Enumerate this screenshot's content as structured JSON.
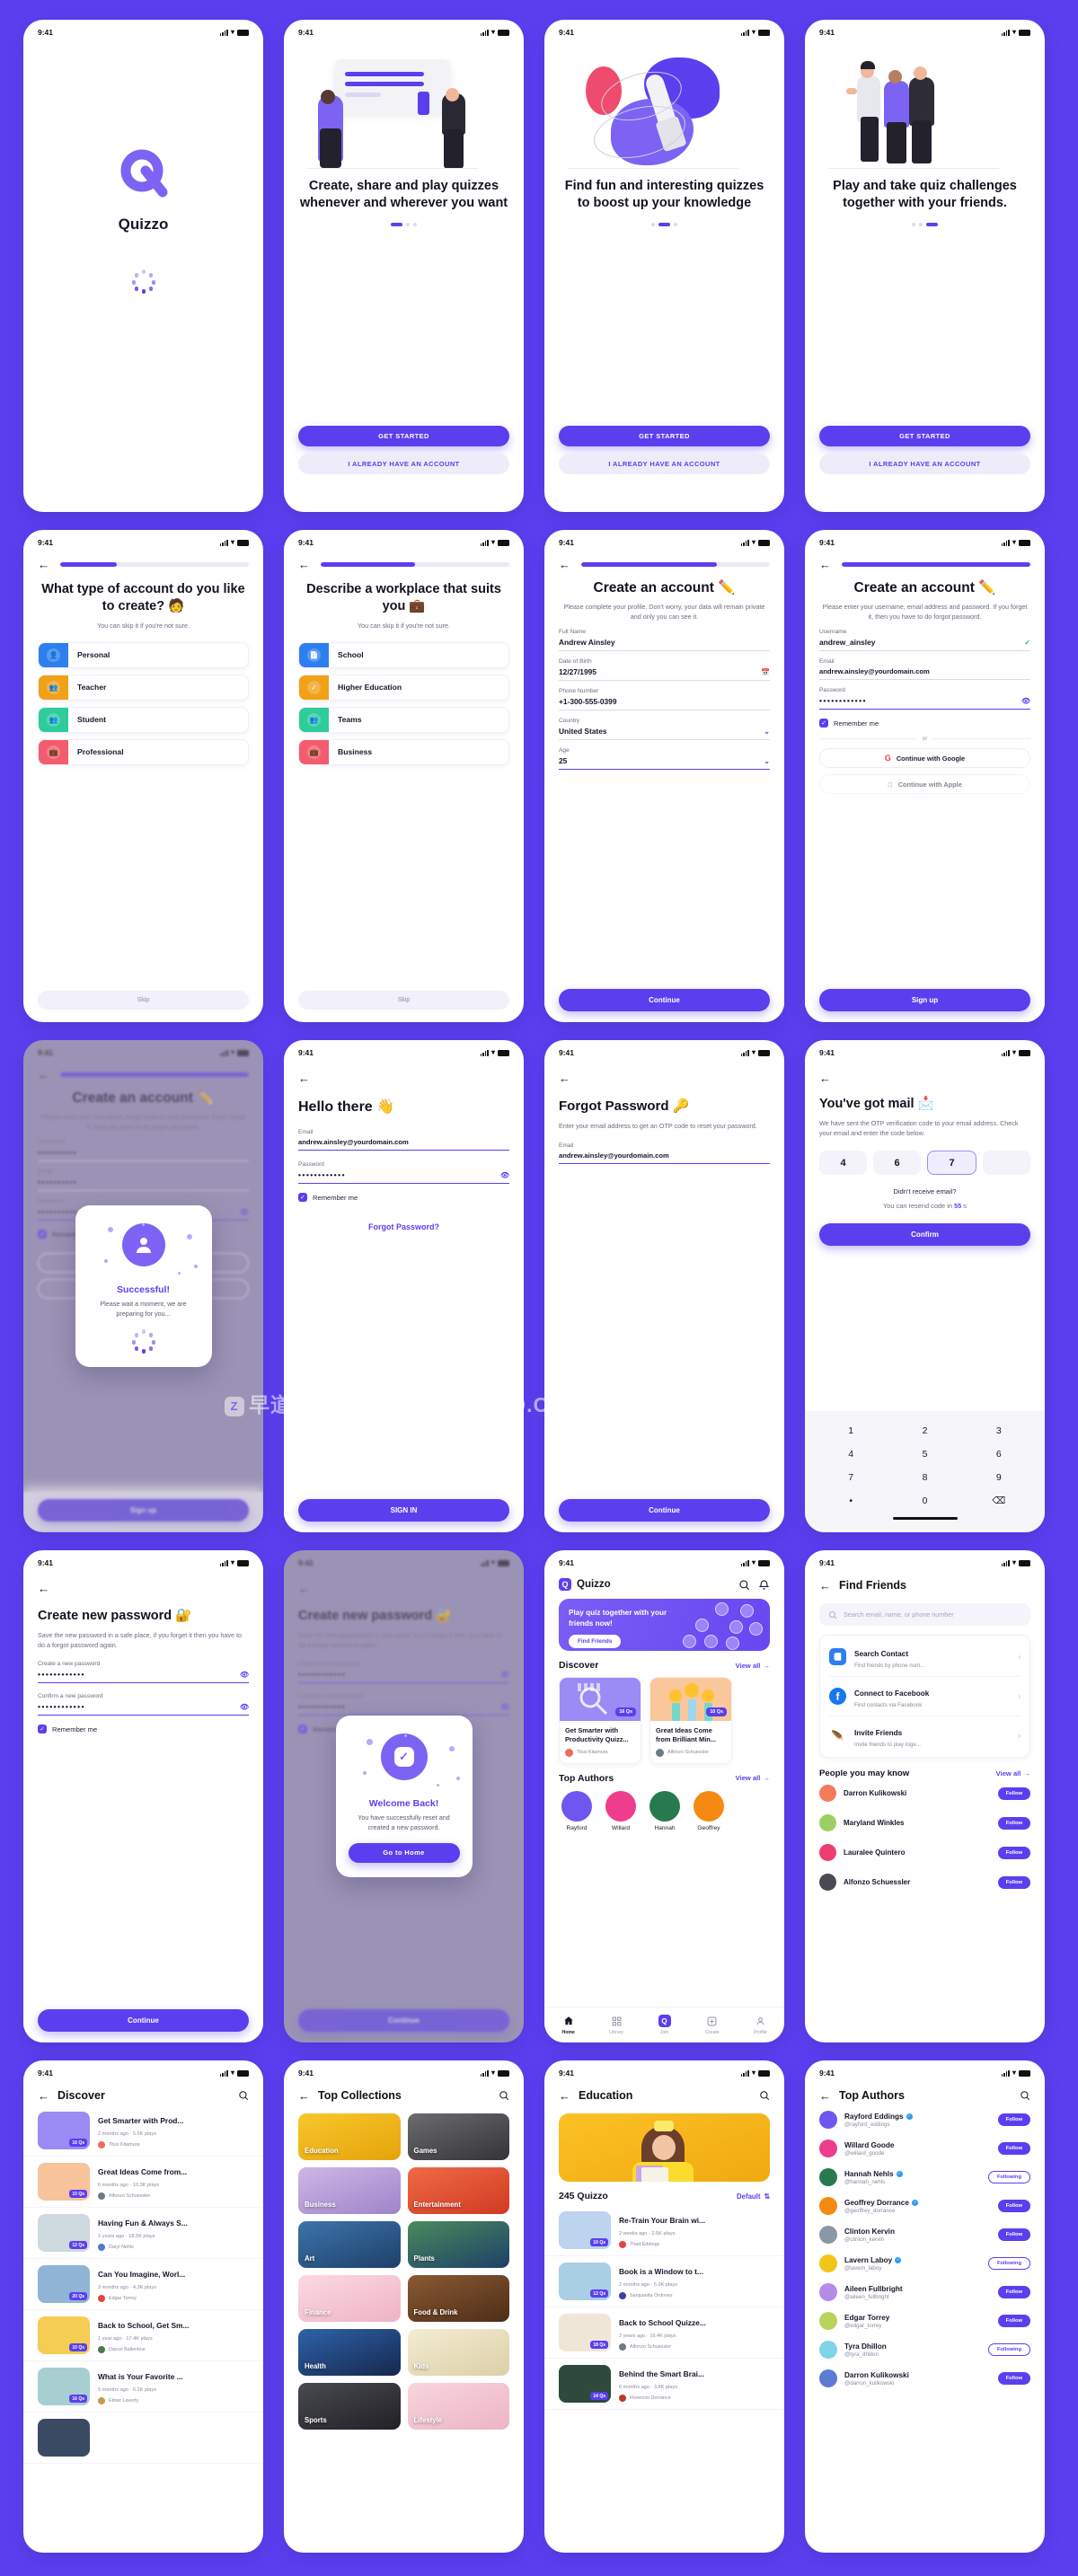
{
  "brand": {
    "name": "Quizzo",
    "accent": "#5B3FEF",
    "logo_glyph": "Q"
  },
  "status_bar": {
    "time": "9:41",
    "icons": [
      "signal-bars",
      "wifi",
      "battery"
    ]
  },
  "watermark": {
    "text_cn": "早道大咖",
    "text_en": "IAMDK.TAOBAO.COM"
  },
  "screens": {
    "splash": {
      "app_name": "Quizzo"
    },
    "onboarding": [
      {
        "headline": "Create, share and play quizzes whenever and wherever you want",
        "active_dot": 0,
        "primary": "GET STARTED",
        "secondary": "I ALREADY HAVE AN ACCOUNT"
      },
      {
        "headline": "Find fun and interesting quizzes to boost up your knowledge",
        "active_dot": 1,
        "primary": "GET STARTED",
        "secondary": "I ALREADY HAVE AN ACCOUNT"
      },
      {
        "headline": "Play and take quiz challenges together with your friends.",
        "active_dot": 2,
        "primary": "GET STARTED",
        "secondary": "I ALREADY HAVE AN ACCOUNT"
      }
    ],
    "account_type": {
      "progress": 30,
      "title": "What type of account do you like to create? 🧑",
      "subtitle": "You can skip it if you're not sure.",
      "options": [
        {
          "label": "Personal",
          "color": "#2D7FF0",
          "icon": "person-icon"
        },
        {
          "label": "Teacher",
          "color": "#F0A117",
          "icon": "people-two-icon"
        },
        {
          "label": "Student",
          "color": "#2ECC9B",
          "icon": "people-group-icon"
        },
        {
          "label": "Professional",
          "color": "#F25C6E",
          "icon": "briefcase-icon"
        }
      ],
      "skip": "Skip"
    },
    "workplace": {
      "progress": 50,
      "title": "Describe a workplace that suits you 💼",
      "subtitle": "You can skip it if you're not sure.",
      "options": [
        {
          "label": "School",
          "color": "#2D7FF0",
          "icon": "document-icon"
        },
        {
          "label": "Higher Education",
          "color": "#F0A117",
          "icon": "check-badge-icon"
        },
        {
          "label": "Teams",
          "color": "#2ECC9B",
          "icon": "people-group-icon"
        },
        {
          "label": "Business",
          "color": "#F25C6E",
          "icon": "briefcase-icon"
        }
      ],
      "skip": "Skip"
    },
    "create_account_profile": {
      "progress": 70,
      "title": "Create an account ✏️",
      "subtitle": "Please complete your profile. Don't worry, your data will remain private and only you can see it.",
      "fields": [
        {
          "label": "Full Name",
          "value": "Andrew Ainsley",
          "icon": null
        },
        {
          "label": "Date of Birth",
          "value": "12/27/1995",
          "icon": "calendar-icon"
        },
        {
          "label": "Phone Number",
          "value": "+1-300-555-0399",
          "icon": null
        },
        {
          "label": "Country",
          "value": "United States",
          "icon": "chevron-down-icon"
        },
        {
          "label": "Age",
          "value": "25",
          "icon": "chevron-down-icon"
        }
      ],
      "cta": "Continue"
    },
    "create_account_credentials": {
      "progress": 100,
      "title": "Create an account ✏️",
      "subtitle": "Please enter your username, email address and password. If you forget it, then you have to do forgot password.",
      "fields": [
        {
          "label": "Username",
          "value": "andrew_ainsley",
          "icon": "check-icon"
        },
        {
          "label": "Email",
          "value": "andrew.ainsley@yourdomain.com",
          "icon": null
        },
        {
          "label": "Password",
          "value": "••••••••••••",
          "icon": "eye-off-icon"
        }
      ],
      "remember_me": "Remember me",
      "or": "or",
      "social": [
        {
          "label": "Continue with Google",
          "icon": "google-icon"
        },
        {
          "label": "Continue with Apple",
          "icon": "apple-icon"
        }
      ],
      "cta": "Sign up"
    },
    "successful_modal": {
      "behind_title": "Create an account ✏️",
      "behind_cta": "Sign up",
      "behind_social": "Continue with Google",
      "modal_title": "Successful!",
      "modal_sub": "Please wait a moment, we are preparing for you...",
      "icon": "user-avatar-icon"
    },
    "sign_in": {
      "title": "Hello there 👋",
      "fields": [
        {
          "label": "Email",
          "value": "andrew.ainsley@yourdomain.com",
          "icon": null
        },
        {
          "label": "Password",
          "value": "••••••••••••",
          "icon": "eye-off-icon"
        }
      ],
      "remember_me": "Remember me",
      "forgot_link": "Forgot Password?",
      "cta": "SIGN IN"
    },
    "forgot_password": {
      "title": "Forgot Password 🔑",
      "subtitle": "Enter your email address to get an OTP code to reset your password.",
      "fields": [
        {
          "label": "Email",
          "value": "andrew.ainsley@yourdomain.com"
        }
      ],
      "cta": "Continue"
    },
    "otp": {
      "title": "You've got mail 📩",
      "subtitle": "We have sent the OTP verification code to your email address. Check your email and enter the code below.",
      "digits": [
        "4",
        "6",
        "7",
        ""
      ],
      "selected_index": 2,
      "resend_q": "Didn't receive email?",
      "resend_pre": "You can resend code in ",
      "resend_count": "55",
      "resend_post": " s",
      "cta": "Confirm",
      "keypad": [
        "1",
        "2",
        "3",
        "4",
        "5",
        "6",
        "7",
        "8",
        "9",
        "•",
        "0",
        "⌫"
      ]
    },
    "new_password": {
      "title": "Create new password 🔐",
      "subtitle": "Save the new password in a safe place, if you forget it then you have to do a forgot password again.",
      "fields": [
        {
          "label": "Create a new password",
          "value": "••••••••••••",
          "icon": "eye-off-icon"
        },
        {
          "label": "Confirm a new password",
          "value": "••••••••••••",
          "icon": "eye-off-icon"
        }
      ],
      "remember_me": "Remember me",
      "cta": "Continue"
    },
    "welcome_back_modal": {
      "behind_title": "Create new password 🔐",
      "behind_cta": "Continue",
      "modal_title": "Welcome Back!",
      "modal_sub": "You have successfully reset and created a new password.",
      "modal_cta": "Go to Home",
      "icon": "check-badge-icon"
    },
    "home": {
      "brand": "Quizzo",
      "header_icons": [
        "search-icon",
        "bell-icon"
      ],
      "banner": {
        "text": "Play quiz together with your friends now!",
        "cta": "Find Friends"
      },
      "discover": {
        "title": "Discover",
        "view_all": "View all",
        "cards": [
          {
            "title": "Get Smarter with Productivity Quizz...",
            "author": "Titus Kitamura",
            "qs": "16 Qs",
            "color": "#9a8bf5"
          },
          {
            "title": "Great Ideas Come from Brilliant Min...",
            "author": "Alfonzo Schuessler",
            "qs": "10 Qs",
            "color": "#f9c79a"
          }
        ]
      },
      "top_authors": {
        "title": "Top Authors",
        "view_all": "View all",
        "authors": [
          {
            "name": "Rayford",
            "color": "#6E56F0"
          },
          {
            "name": "Willard",
            "color": "#EE3D8C"
          },
          {
            "name": "Hannah",
            "color": "#277A4E"
          },
          {
            "name": "Geoffrey",
            "color": "#F58A12"
          }
        ]
      },
      "tabs": [
        {
          "label": "Home",
          "icon": "home-icon",
          "active": true
        },
        {
          "label": "Library",
          "icon": "grid-icon",
          "active": false
        },
        {
          "label": "Join",
          "icon": "quizzo-logo-icon",
          "active": false
        },
        {
          "label": "Create",
          "icon": "plus-box-icon",
          "active": false
        },
        {
          "label": "Profile",
          "icon": "person-icon",
          "active": false
        }
      ]
    },
    "find_friends": {
      "nav_title": "Find Friends",
      "search_placeholder": "Search email, name, or phone number",
      "methods": [
        {
          "title": "Search Contact",
          "sub": "Find friends by phone num...",
          "icon": "contact-book-icon",
          "color": "#2D7FF0"
        },
        {
          "title": "Connect to Facebook",
          "sub": "Find contacts via Facebook",
          "icon": "facebook-icon",
          "color": "#1877F2"
        },
        {
          "title": "Invite Friends",
          "sub": "Invite friends to play toge...",
          "icon": "feather-icon",
          "color": "#8B4A2B"
        }
      ],
      "people_title": "People you may know",
      "people_view_all": "View all",
      "people": [
        {
          "name": "Darron Kulikowski",
          "action": "Follow",
          "following": false,
          "color": "#F47C5B"
        },
        {
          "name": "Maryland Winkles",
          "action": "Follow",
          "following": false,
          "color": "#9BCF62"
        },
        {
          "name": "Lauralee Quintero",
          "action": "Follow",
          "following": false,
          "color": "#EE3D6F"
        },
        {
          "name": "Alfonzo Schuessler",
          "action": "Follow",
          "following": false,
          "color": "#4A4A55"
        }
      ]
    },
    "discover_page": {
      "nav_title": "Discover",
      "items": [
        {
          "title": "Get Smarter with Prod...",
          "meta": "2 months ago  ·  5.6K plays",
          "author": "Titus Kitamura",
          "qs": "16 Qs",
          "color": "#9a8bf5",
          "avatar": "#F26B5A"
        },
        {
          "title": "Great Ideas Come from...",
          "meta": "6 months ago  ·  10.3K plays",
          "author": "Alfonzo Schuessler",
          "qs": "10 Qs",
          "color": "#f8c49b",
          "avatar": "#6E7A85"
        },
        {
          "title": "Having Fun & Always S...",
          "meta": "2 years ago  ·  18.5K plays",
          "author": "Daryl Nehls",
          "qs": "12 Qs",
          "color": "#cfd9e0",
          "avatar": "#4E79C9"
        },
        {
          "title": "Can You Imagine, Worl...",
          "meta": "3 months ago  ·  4.3K plays",
          "author": "Edgar Torrey",
          "qs": "20 Qs",
          "color": "#8fb4d6",
          "avatar": "#E5453F"
        },
        {
          "title": "Back to School, Get Sm...",
          "meta": "1 year ago  ·  17.4K plays",
          "author": "Darcel Ballentine",
          "qs": "10 Qs",
          "color": "#f5cd53",
          "avatar": "#4C7A45"
        },
        {
          "title": "What is Your Favorite ...",
          "meta": "5 months ago  ·  6.2K plays",
          "author": "Elmer Laverty",
          "qs": "16 Qs",
          "color": "#a7cfd2",
          "avatar": "#C89A4C"
        }
      ]
    },
    "top_collections": {
      "nav_title": "Top Collections",
      "items": [
        {
          "label": "Education",
          "color": "#F2B818"
        },
        {
          "label": "Games",
          "color": "#4A4B4F"
        },
        {
          "label": "Business",
          "color": "#B79BD8"
        },
        {
          "label": "Entertainment",
          "color": "#E4563A"
        },
        {
          "label": "Art",
          "color": "#2A5A8C"
        },
        {
          "label": "Plants",
          "color": "#2E5A86"
        },
        {
          "label": "Finance",
          "color": "#F6C9D6"
        },
        {
          "label": "Food & Drink",
          "color": "#6B4226"
        },
        {
          "label": "Health",
          "color": "#1E3E72"
        },
        {
          "label": "Kids",
          "color": "#E9DFC0"
        },
        {
          "label": "Sports",
          "color": "#2E2E33"
        },
        {
          "label": "Lifestyle",
          "color": "#F0C5CE"
        }
      ]
    },
    "education": {
      "nav_title": "Education",
      "count": "245 Quizzo",
      "sort": "Default",
      "items": [
        {
          "title": "Re-Train Your Brain wi...",
          "meta": "2 weeks ago  ·  2.5K plays",
          "author": "Thad Eddings",
          "qs": "10 Qs",
          "color": "#bcd4ee",
          "avatar": "#E5453F"
        },
        {
          "title": "Book is a Window to t...",
          "meta": "2 months ago  ·  5.9K plays",
          "author": "Sanjuanita Ordonez",
          "qs": "12 Qs",
          "color": "#a9cfe4",
          "avatar": "#3A3FA8"
        },
        {
          "title": "Back to School Quizze...",
          "meta": "2 years ago  ·  16.4K plays",
          "author": "Alfonzo Schuessler",
          "qs": "18 Qs",
          "color": "#efe6d8",
          "avatar": "#6E7A85"
        },
        {
          "title": "Behind the Smart Brai...",
          "meta": "6 months ago  ·  3.8K plays",
          "author": "Florencio Dorrance",
          "qs": "14 Qs",
          "color": "#2f4a3c",
          "avatar": "#C0392B"
        }
      ]
    },
    "top_authors_page": {
      "nav_title": "Top Authors",
      "authors": [
        {
          "name": "Rayford Eddings",
          "handle": "@rayford_eddings",
          "verified": true,
          "action": "Follow",
          "following": false,
          "color": "#6E56F0"
        },
        {
          "name": "Willard Goode",
          "handle": "@willard_goode",
          "verified": false,
          "action": "Follow",
          "following": false,
          "color": "#EE3D8C"
        },
        {
          "name": "Hannah Nehls",
          "handle": "@hannah_nehls",
          "verified": true,
          "action": "Following",
          "following": true,
          "color": "#277A4E"
        },
        {
          "name": "Geoffrey Dorrance",
          "handle": "@geoffrey_dorrance",
          "verified": true,
          "action": "Follow",
          "following": false,
          "color": "#F58A12"
        },
        {
          "name": "Clinton Kervin",
          "handle": "@clinton_kervin",
          "verified": false,
          "action": "Follow",
          "following": false,
          "color": "#8A98A6"
        },
        {
          "name": "Lavern Laboy",
          "handle": "@lavern_laboy",
          "verified": true,
          "action": "Following",
          "following": true,
          "color": "#F3C41A"
        },
        {
          "name": "Aileen Fullbright",
          "handle": "@aileen_fullbright",
          "verified": false,
          "action": "Follow",
          "following": false,
          "color": "#B68BE8"
        },
        {
          "name": "Edgar Torrey",
          "handle": "@edgar_torrey",
          "verified": false,
          "action": "Follow",
          "following": false,
          "color": "#B9D45A"
        },
        {
          "name": "Tyra Dhillon",
          "handle": "@tyra_dhillon",
          "verified": false,
          "action": "Following",
          "following": true,
          "color": "#7FD4E8"
        },
        {
          "name": "Darron Kulikowski",
          "handle": "@darron_kulikowski",
          "verified": false,
          "action": "Follow",
          "following": false,
          "color": "#5B7BD4"
        }
      ]
    }
  }
}
